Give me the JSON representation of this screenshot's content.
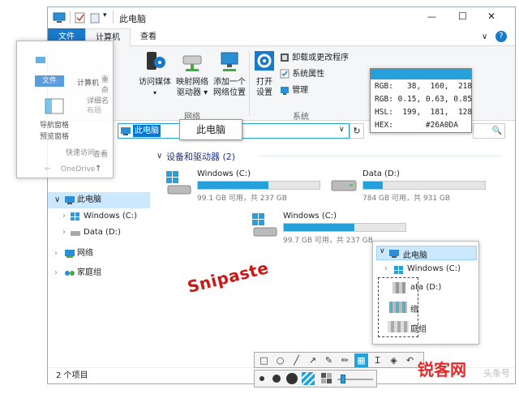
{
  "window": {
    "title": "此电脑",
    "qat_arrow": "▾",
    "minimize": "—",
    "maximize": "☐",
    "close": "✕"
  },
  "ribbon": {
    "tab_file": "文件",
    "tab_computer": "计算机",
    "tab_view": "查看",
    "help": "?",
    "expand": "∨",
    "group_network": "网络",
    "group_system": "系统",
    "btn_access_media": "访问媒体",
    "btn_map_drive": "映射网络",
    "btn_map_drive2": "驱动器 ▾",
    "btn_add_location": "添加一个",
    "btn_add_location2": "网络位置",
    "btn_open_settings": "打开",
    "btn_open_settings2": "设置",
    "btn_uninstall": "卸载或更改程序",
    "btn_system_props": "系统属性",
    "btn_manage": "管理",
    "dropdown_arrow": "▾"
  },
  "address": {
    "selected_text": "此电脑",
    "tooltip": "此电脑",
    "dropdown": "∨",
    "refresh": "↻",
    "search_icon": "🔍"
  },
  "section": {
    "title": "设备和驱动器 (2)",
    "chevron": "∨"
  },
  "drives": [
    {
      "name": "Windows (C:)",
      "size": "99.1 GB 可用，共 237 GB",
      "fill": 0.58
    },
    {
      "name": "Data (D:)",
      "size": "784 GB 可用，共 931 GB",
      "fill": 0.16
    },
    {
      "name": "Windows (C:)",
      "size": "99.7 GB 可用，共 237 GB",
      "fill": 0.58
    }
  ],
  "nav": {
    "this_pc": "此电脑",
    "windows_c": "Windows (C:)",
    "data_d": "Data (D:)",
    "network": "网络",
    "homegroup": "家庭组",
    "one_drive": "OneDri",
    "chevron_right": "›",
    "chevron_down": "∨"
  },
  "status": {
    "count": "2 个项目"
  },
  "ghost": {
    "tab_file": "文件",
    "tab_computer": "计算机",
    "rename": "重命名",
    "nav_pane": "导航窗格",
    "preview_pane": "预览窗格",
    "details": "详细",
    "layout": "布局",
    "quick_access": "快速访问",
    "one_drive": "OneDrive",
    "view": "查看",
    "arrow_up": "↑",
    "arrow_left": "←",
    "arrow_right": "→"
  },
  "color_picker": {
    "color": "#26A0DA",
    "lines": [
      "RGB:   38,  160,  218",
      "RGB: 0.15, 0.63, 0.85",
      "HSL:  199,  181,  128",
      "HEX:       #26A0DA"
    ]
  },
  "mini_tree": {
    "this_pc": "此电脑",
    "windows_c": "Windows (C:)",
    "data_d": "ata (D:)",
    "network_tail": "络",
    "homegroup_tail": "庭组",
    "chevron_down": "∨",
    "chevron_right": "›"
  },
  "annotation": {
    "text": "Snipaste"
  },
  "toolbar": {
    "tools": [
      "□",
      "○",
      "╱",
      "↗",
      "✎",
      "✏",
      "▦",
      "Ｉ",
      "◈",
      "↶"
    ],
    "tool_names": [
      "rectangle",
      "ellipse",
      "line",
      "arrow",
      "pen",
      "marker",
      "mosaic",
      "text",
      "eraser",
      "undo"
    ]
  },
  "watermark": {
    "text": "锐客网",
    "text2": "头条号"
  },
  "colors": {
    "accent": "#26A0DA",
    "file_tab": "#1979CA",
    "annotation": "#D01515"
  }
}
